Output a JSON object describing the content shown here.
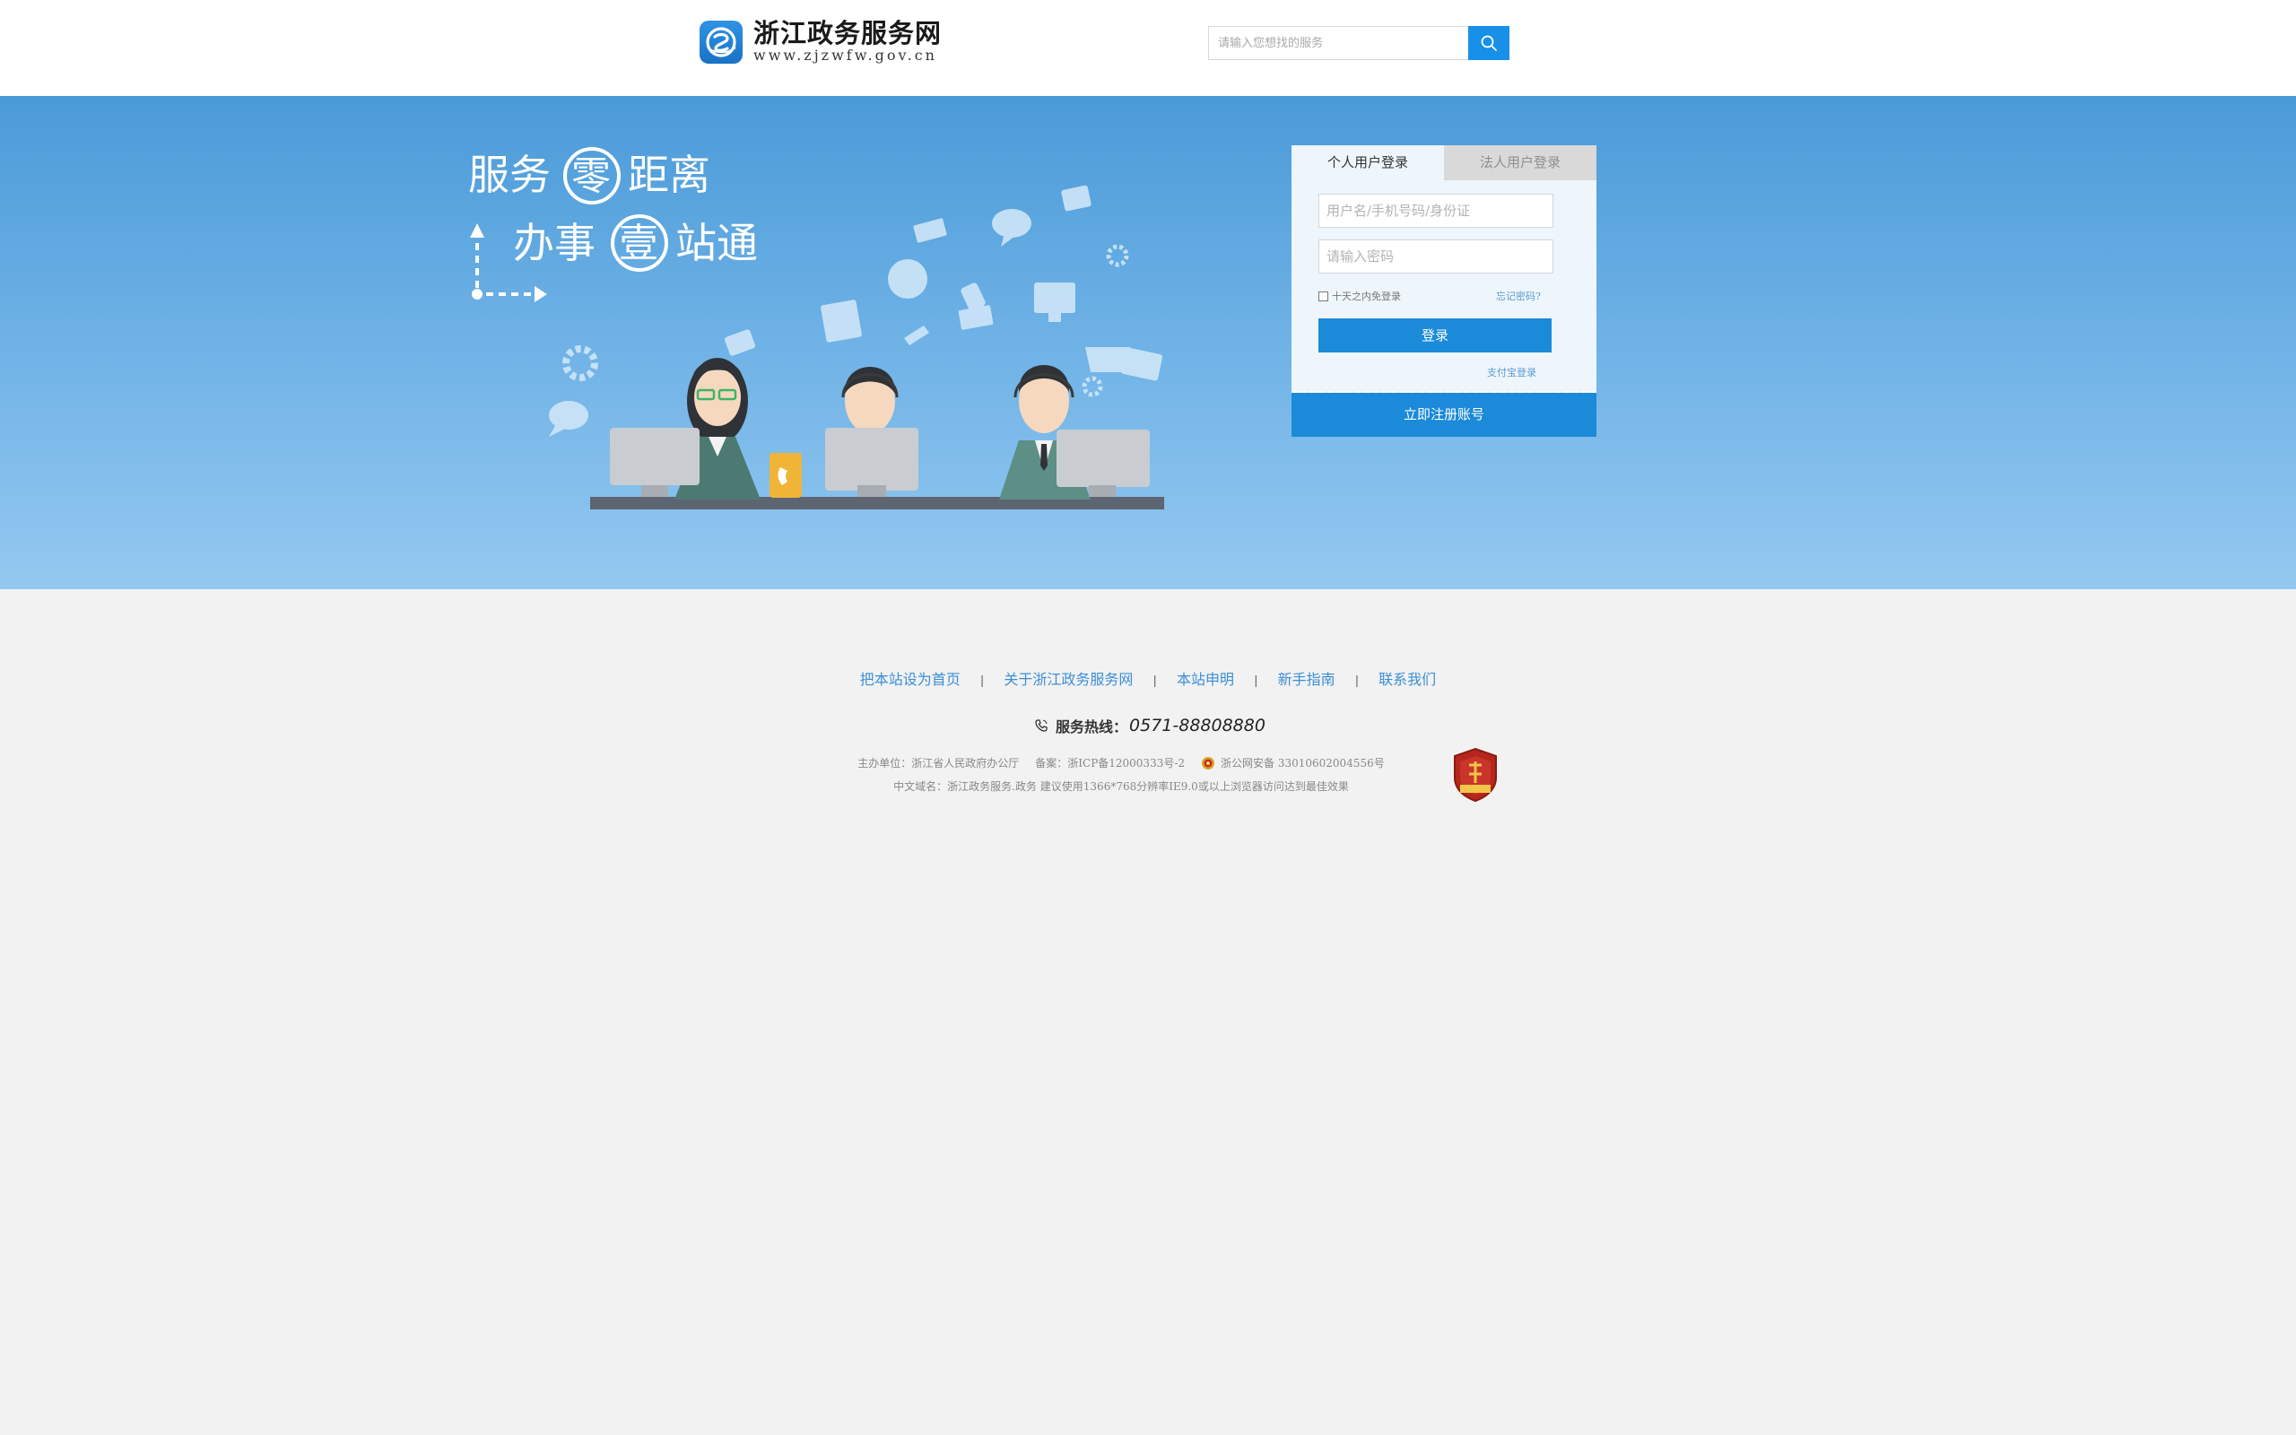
{
  "header": {
    "logo": {
      "title": "浙江政务服务网",
      "url": "www.zjzwfw.gov.cn"
    },
    "search": {
      "placeholder": "请输入您想找的服务",
      "button_icon": "search-icon"
    }
  },
  "banner": {
    "slogan_line_1": "服务零距离",
    "slogan_line_2": "办事壹站通"
  },
  "login": {
    "tabs": [
      {
        "label": "个人用户登录",
        "active": true
      },
      {
        "label": "法人用户登录",
        "active": false
      }
    ],
    "username_placeholder": "用户名/手机号码/身份证",
    "password_placeholder": "请输入密码",
    "remember_label": "十天之内免登录",
    "forgot_label": "忘记密码?",
    "login_button": "登录",
    "alipay_link": "支付宝登录",
    "register_button": "立即注册账号"
  },
  "footer": {
    "links": [
      "把本站设为首页",
      "关于浙江政务服务网",
      "本站申明",
      "新手指南",
      "联系我们"
    ],
    "separator": "|",
    "hotline_label": "服务热线：",
    "hotline_number": "0571-88808880",
    "organizer": "主办单位：浙江省人民政府办公厅",
    "icp": "备案：浙ICP备12000333号-2",
    "police": "浙公网安备 33010602004556号",
    "domain_note": "中文域名：浙江政务服务.政务  建议使用1366*768分辨率IE9.0或以上浏览器访问达到最佳效果",
    "badge_icon": "party-government-badge-icon"
  },
  "colors": {
    "primary": "#1a8ad9",
    "link": "#3b8fd6",
    "banner_top": "#4a9ad8",
    "banner_bottom": "#94c8f0",
    "page_bg": "#f2f2f2"
  }
}
